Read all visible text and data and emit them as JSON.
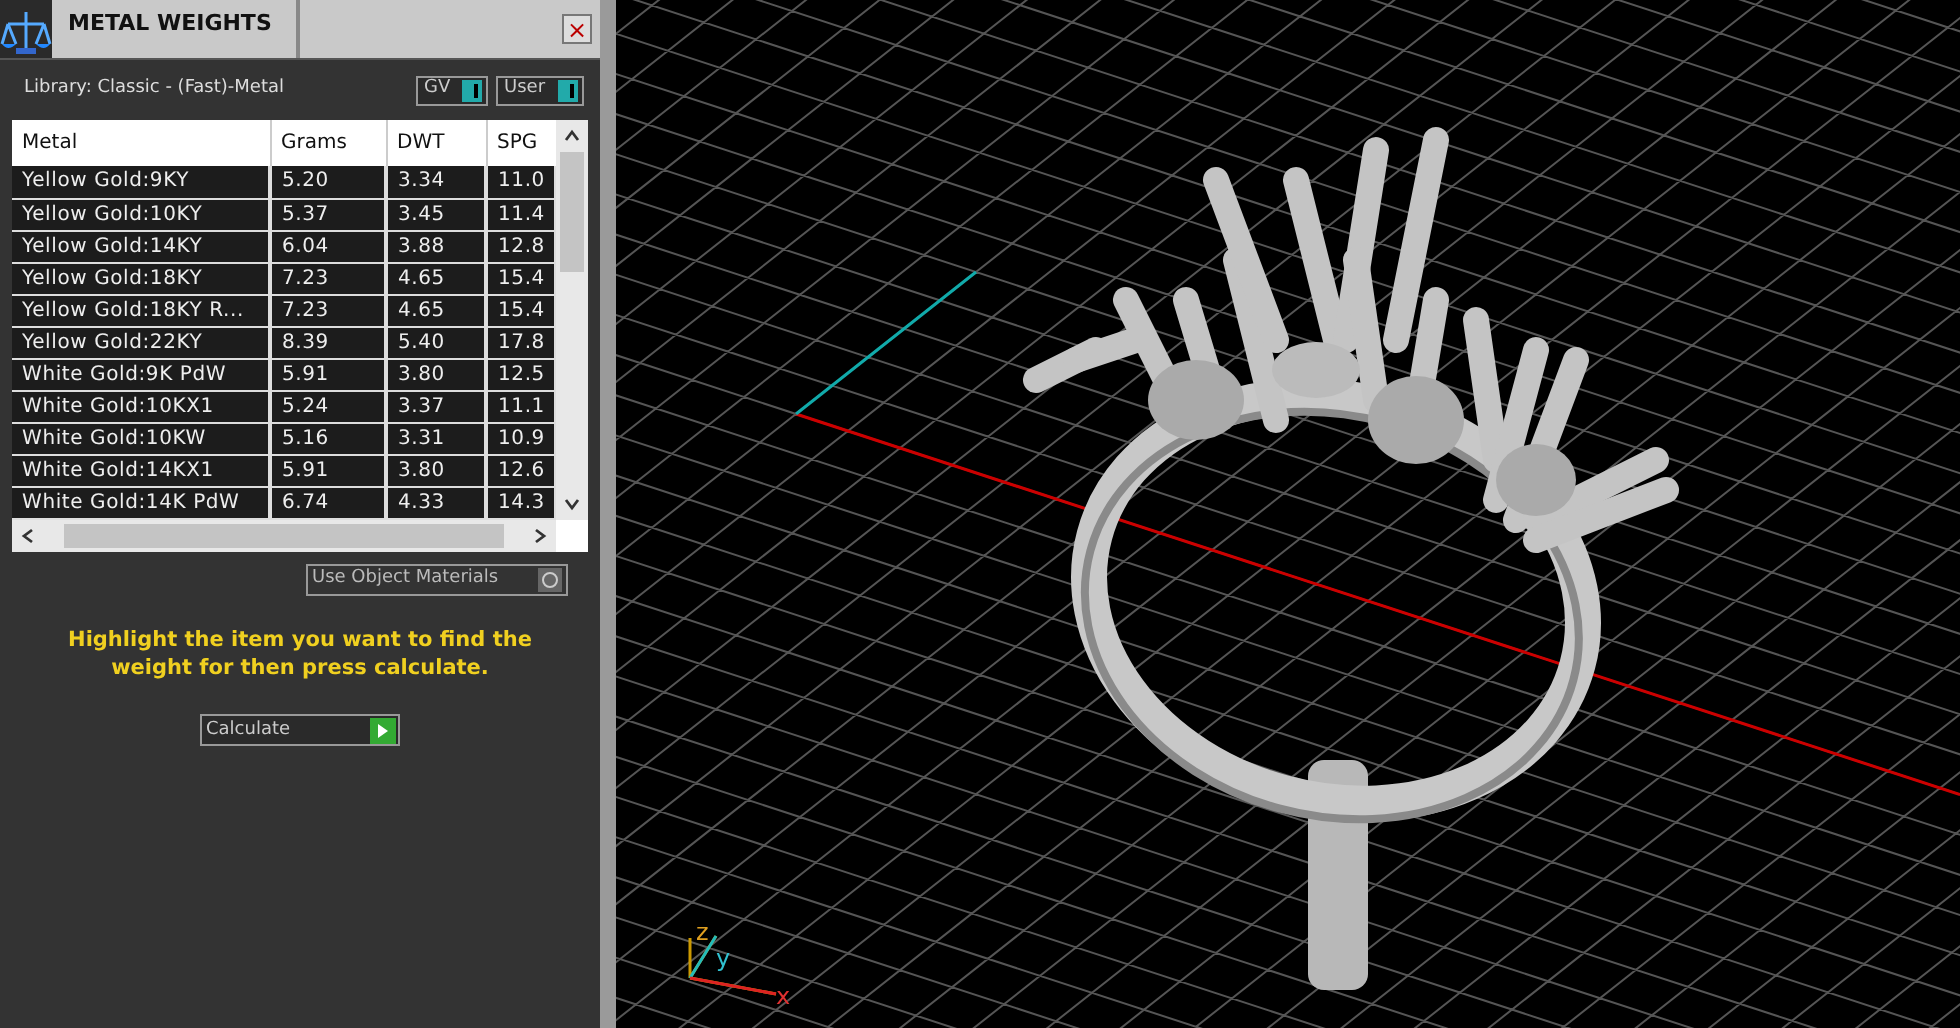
{
  "panel": {
    "title": "METAL WEIGHTS",
    "close": "×",
    "library": "Library: Classic - (Fast)-Metal",
    "toggles": [
      {
        "label": "GV",
        "on": true
      },
      {
        "label": "User",
        "on": true
      }
    ],
    "table": {
      "columns": [
        "Metal",
        "Grams",
        "DWT",
        "SPG"
      ],
      "rows": [
        {
          "cells": [
            "Yellow Gold:9KY",
            "5.20",
            "3.34",
            "11.0"
          ],
          "selected": false
        },
        {
          "cells": [
            "Yellow Gold:10KY",
            "5.37",
            "3.45",
            "11.4"
          ],
          "selected": false
        },
        {
          "cells": [
            "Yellow Gold:14KY",
            "6.04",
            "3.88",
            "12.8"
          ],
          "selected": false
        },
        {
          "cells": [
            "Yellow Gold:18KY",
            "7.23",
            "4.65",
            "15.4"
          ],
          "selected": false
        },
        {
          "cells": [
            "Yellow Gold:18KY R...",
            "7.23",
            "4.65",
            "15.4"
          ],
          "selected": false
        },
        {
          "cells": [
            "Yellow Gold:22KY",
            "8.39",
            "5.40",
            "17.8"
          ],
          "selected": false
        },
        {
          "cells": [
            "White Gold:9K PdW",
            "5.91",
            "3.80",
            "12.5"
          ],
          "selected": false
        },
        {
          "cells": [
            "White Gold:10KX1",
            "5.24",
            "3.37",
            "11.1"
          ],
          "selected": false
        },
        {
          "cells": [
            "White Gold:10KW",
            "5.16",
            "3.31",
            "10.9"
          ],
          "selected": false
        },
        {
          "cells": [
            "White Gold:14KX1",
            "5.91",
            "3.80",
            "12.6"
          ],
          "selected": false
        },
        {
          "cells": [
            "White Gold:14K PdW",
            "6.74",
            "4.33",
            "14.3"
          ],
          "selected": false
        }
      ]
    },
    "use_object_materials": {
      "label": "Use Object Materials",
      "checked": false
    },
    "instruction": "Highlight the item you want to find the weight for then press calculate.",
    "calculate_button": "Calculate"
  },
  "viewport": {
    "axes": [
      "z",
      "y",
      "x"
    ]
  }
}
